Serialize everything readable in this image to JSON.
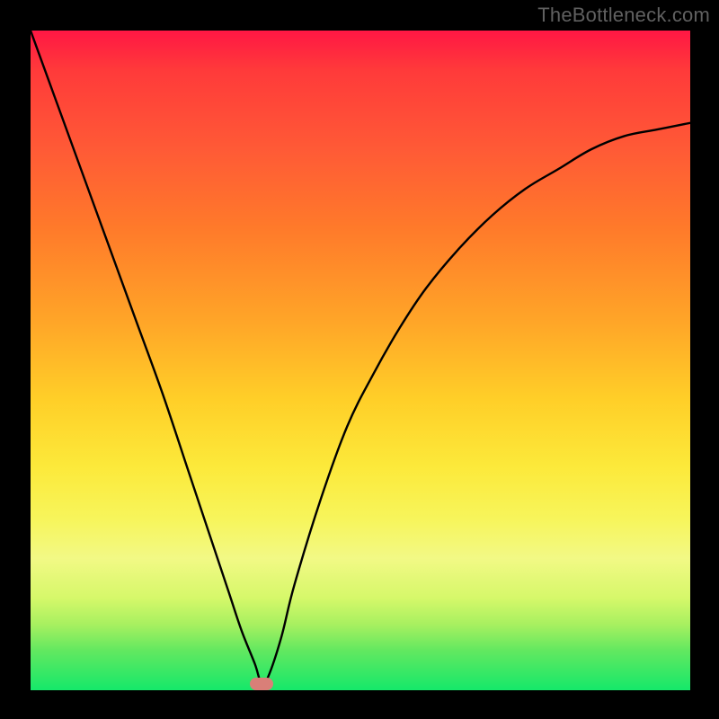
{
  "watermark": "TheBottleneck.com",
  "chart_data": {
    "type": "line",
    "title": "",
    "xlabel": "",
    "ylabel": "",
    "xlim": [
      0,
      100
    ],
    "ylim": [
      0,
      100
    ],
    "grid": false,
    "legend": "none",
    "background_gradient": {
      "top": "#ff1744",
      "middle": "#ffd740",
      "bottom": "#15e86a"
    },
    "series": [
      {
        "name": "bottleneck-curve",
        "x": [
          0,
          4,
          8,
          12,
          16,
          20,
          24,
          27,
          30,
          32,
          34,
          35,
          36,
          38,
          40,
          44,
          48,
          52,
          56,
          60,
          65,
          70,
          75,
          80,
          85,
          90,
          95,
          100
        ],
        "values": [
          100,
          89,
          78,
          67,
          56,
          45,
          33,
          24,
          15,
          9,
          4,
          1,
          2,
          8,
          16,
          29,
          40,
          48,
          55,
          61,
          67,
          72,
          76,
          79,
          82,
          84,
          85,
          86
        ]
      }
    ],
    "marker": {
      "name": "minimum-point",
      "x": 35,
      "y": 1,
      "color": "#d97f78"
    }
  }
}
